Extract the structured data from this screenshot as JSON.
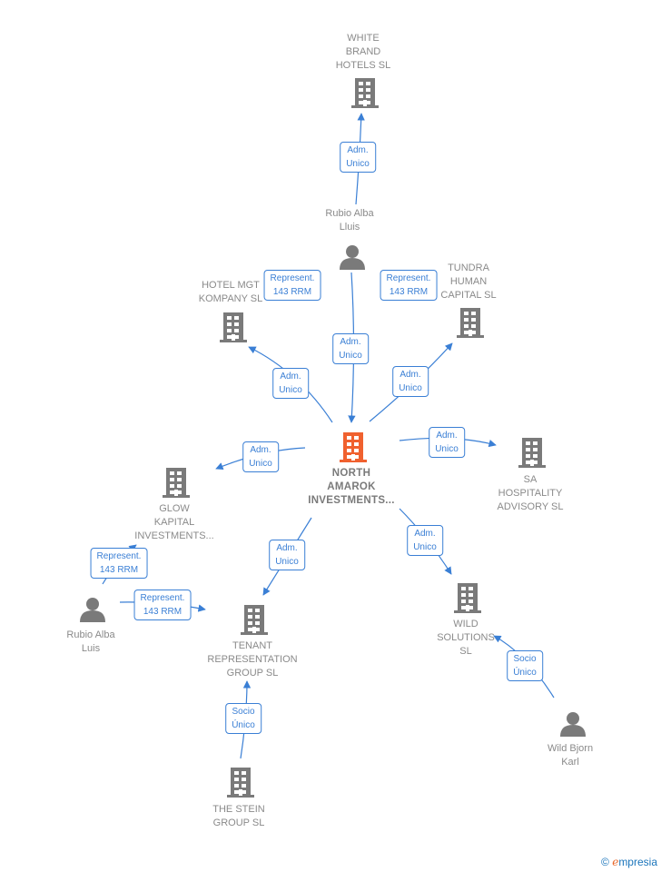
{
  "colors": {
    "edge": "#3a7fd5",
    "node": "#7a7a7a",
    "main": "#f0612f"
  },
  "nodes": [
    {
      "id": "white-brand",
      "type": "company",
      "lines": [
        "WHITE",
        "BRAND",
        "HOTELS  SL"
      ]
    },
    {
      "id": "rubio-alba-lluis",
      "type": "person",
      "lines": [
        "Rubio Alba",
        "Lluis"
      ]
    },
    {
      "id": "hotel-mgt",
      "type": "company",
      "lines": [
        "HOTEL MGT",
        "KOMPANY  SL"
      ]
    },
    {
      "id": "tundra",
      "type": "company",
      "lines": [
        "TUNDRA",
        "HUMAN",
        "CAPITAL  SL"
      ]
    },
    {
      "id": "north-amarok",
      "type": "company-main",
      "lines": [
        "NORTH",
        "AMAROK",
        "INVESTMENTS..."
      ]
    },
    {
      "id": "sa-hospitality",
      "type": "company",
      "lines": [
        "SA",
        "HOSPITALITY",
        "ADVISORY SL"
      ]
    },
    {
      "id": "glow-kapital",
      "type": "company",
      "lines": [
        "GLOW",
        "KAPITAL",
        "INVESTMENTS..."
      ]
    },
    {
      "id": "rubio-alba-luis",
      "type": "person",
      "lines": [
        "Rubio Alba",
        "Luis"
      ]
    },
    {
      "id": "tenant",
      "type": "company",
      "lines": [
        "TENANT",
        "REPRESENTATION",
        "GROUP  SL"
      ]
    },
    {
      "id": "wild-solutions",
      "type": "company",
      "lines": [
        "WILD",
        "SOLUTIONS",
        "SL"
      ]
    },
    {
      "id": "wild-bjorn",
      "type": "person",
      "lines": [
        "Wild Bjorn",
        "Karl"
      ]
    },
    {
      "id": "stein",
      "type": "company",
      "lines": [
        "THE STEIN",
        "GROUP SL"
      ]
    }
  ],
  "edges": [
    {
      "label": [
        "Adm.",
        "Unico"
      ]
    },
    {
      "label": [
        "Represent.",
        "143 RRM"
      ]
    },
    {
      "label": [
        "Represent.",
        "143 RRM"
      ]
    },
    {
      "label": [
        "Adm.",
        "Unico"
      ]
    },
    {
      "label": [
        "Adm.",
        "Unico"
      ]
    },
    {
      "label": [
        "Adm.",
        "Unico"
      ]
    },
    {
      "label": [
        "Adm.",
        "Unico"
      ]
    },
    {
      "label": [
        "Adm.",
        "Unico"
      ]
    },
    {
      "label": [
        "Adm.",
        "Unico"
      ]
    },
    {
      "label": [
        "Adm.",
        "Unico"
      ]
    },
    {
      "label": [
        "Represent.",
        "143 RRM"
      ]
    },
    {
      "label": [
        "Represent.",
        "143 RRM"
      ]
    },
    {
      "label": [
        "Socio",
        "Único"
      ]
    },
    {
      "label": [
        "Socio",
        "Único"
      ]
    }
  ],
  "footer": {
    "copyright": "©",
    "brand_e": "e",
    "brand": "mpresia"
  }
}
